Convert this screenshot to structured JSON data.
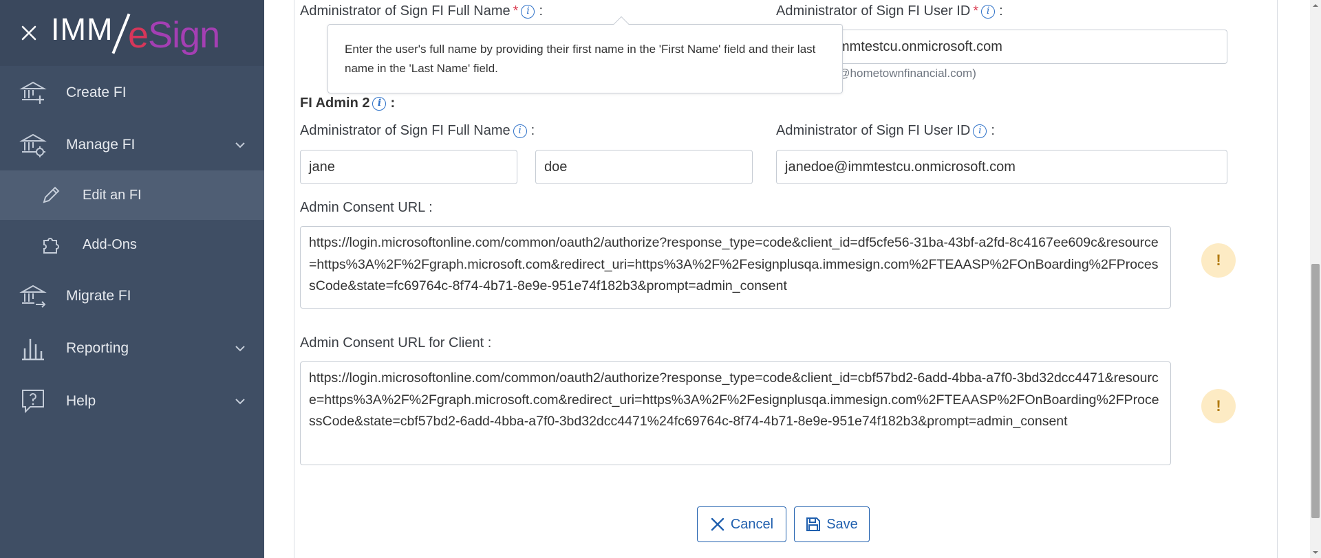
{
  "brand": {
    "prefix": "IMM",
    "suffix_e": "e",
    "suffix_sign": "Sign"
  },
  "sidebar": {
    "items": [
      {
        "label": "Create FI",
        "icon": "bank-plus-icon"
      },
      {
        "label": "Manage FI",
        "icon": "bank-gear-icon",
        "expanded": true
      },
      {
        "label": "Edit an FI",
        "icon": "pencil-icon",
        "active": true
      },
      {
        "label": "Add-Ons",
        "icon": "puzzle-icon"
      },
      {
        "label": "Migrate FI",
        "icon": "bank-arrow-icon"
      },
      {
        "label": "Reporting",
        "icon": "bar-chart-icon"
      },
      {
        "label": "Help",
        "icon": "question-bubble-icon"
      }
    ]
  },
  "admin1": {
    "full_name_label": "Administrator of Sign FI Full Name",
    "required_mark": "*",
    "user_id_label": "Administrator of Sign FI User ID",
    "user_id_value": "llteller@immtestcu.onmicrosoft.com",
    "user_id_hint": "admin@hometownfinancial.com)"
  },
  "tooltip": {
    "text": "Enter the user's full name by providing their first name in the 'First Name' field and their last name in the 'Last Name' field."
  },
  "admin2": {
    "section_label": "FI Admin 2",
    "full_name_label": "Administrator of Sign FI Full Name",
    "first_name": "jane",
    "last_name": "doe",
    "user_id_label": "Administrator of Sign FI User ID",
    "user_id_value": "janedoe@immtestcu.onmicrosoft.com"
  },
  "consent": {
    "label": "Admin Consent URL :",
    "url": "https://login.microsoftonline.com/common/oauth2/authorize?response_type=code&client_id=df5cfe56-31ba-43bf-a2fd-8c4167ee609c&resource=https%3A%2F%2Fgraph.microsoft.com&redirect_uri=https%3A%2F%2Fesignplusqa.immesign.com%2FTEAASP%2FOnBoarding%2FProcessCode&state=fc69764c-8f74-4b71-8e9e-951e74f182b3&prompt=admin_consent",
    "client_label": "Admin Consent URL for Client :",
    "client_url": "https://login.microsoftonline.com/common/oauth2/authorize?response_type=code&client_id=cbf57bd2-6add-4bba-a7f0-3bd32dcc4471&resource=https%3A%2F%2Fgraph.microsoft.com&redirect_uri=https%3A%2F%2Fesignplusqa.immesign.com%2FTEAASP%2FOnBoarding%2FProcessCode&state=cbf57bd2-6add-4bba-a7f0-3bd32dcc4471%24fc69764c-8f74-4b71-8e9e-951e74f182b3&prompt=admin_consent",
    "warning_glyph": "!"
  },
  "actions": {
    "cancel": "Cancel",
    "save": "Save"
  },
  "colors": {
    "sidebar": "#3f4e64",
    "accent": "#1f5fae",
    "required": "#d9394e",
    "warning_bg": "#fdebc4"
  }
}
